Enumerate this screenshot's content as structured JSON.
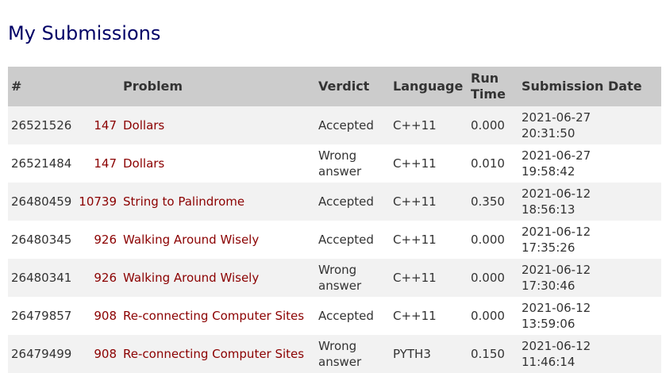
{
  "page": {
    "title": "My Submissions"
  },
  "table": {
    "headers": {
      "id": "#",
      "problem": "Problem",
      "verdict": "Verdict",
      "language": "Language",
      "run_time_line1": "Run",
      "run_time_line2": "Time",
      "date": "Submission Date"
    },
    "rows": [
      {
        "id": "26521526",
        "pnum": "147",
        "pname": "Dollars",
        "verdict": "Accepted",
        "verdict2": "",
        "lang": "C++11",
        "time": "0.000",
        "date": "2021-06-27",
        "clock": "20:31:50"
      },
      {
        "id": "26521484",
        "pnum": "147",
        "pname": "Dollars",
        "verdict": "Wrong",
        "verdict2": "answer",
        "lang": "C++11",
        "time": "0.010",
        "date": "2021-06-27",
        "clock": "19:58:42"
      },
      {
        "id": "26480459",
        "pnum": "10739",
        "pname": "String to Palindrome",
        "verdict": "Accepted",
        "verdict2": "",
        "lang": "C++11",
        "time": "0.350",
        "date": "2021-06-12",
        "clock": "18:56:13"
      },
      {
        "id": "26480345",
        "pnum": "926",
        "pname": "Walking Around Wisely",
        "verdict": "Accepted",
        "verdict2": "",
        "lang": "C++11",
        "time": "0.000",
        "date": "2021-06-12",
        "clock": "17:35:26"
      },
      {
        "id": "26480341",
        "pnum": "926",
        "pname": "Walking Around Wisely",
        "verdict": "Wrong",
        "verdict2": "answer",
        "lang": "C++11",
        "time": "0.000",
        "date": "2021-06-12",
        "clock": "17:30:46"
      },
      {
        "id": "26479857",
        "pnum": "908",
        "pname": "Re-connecting Computer Sites",
        "verdict": "Accepted",
        "verdict2": "",
        "lang": "C++11",
        "time": "0.000",
        "date": "2021-06-12",
        "clock": "13:59:06"
      },
      {
        "id": "26479499",
        "pnum": "908",
        "pname": "Re-connecting Computer Sites",
        "verdict": "Wrong",
        "verdict2": "answer",
        "lang": "PYTH3",
        "time": "0.150",
        "date": "2021-06-12",
        "clock": "11:46:14"
      }
    ]
  },
  "colors": {
    "title": "#000066",
    "header_bg": "#cccccc",
    "row_odd_bg": "#f2f2f2",
    "problem_link": "#8b0000"
  }
}
